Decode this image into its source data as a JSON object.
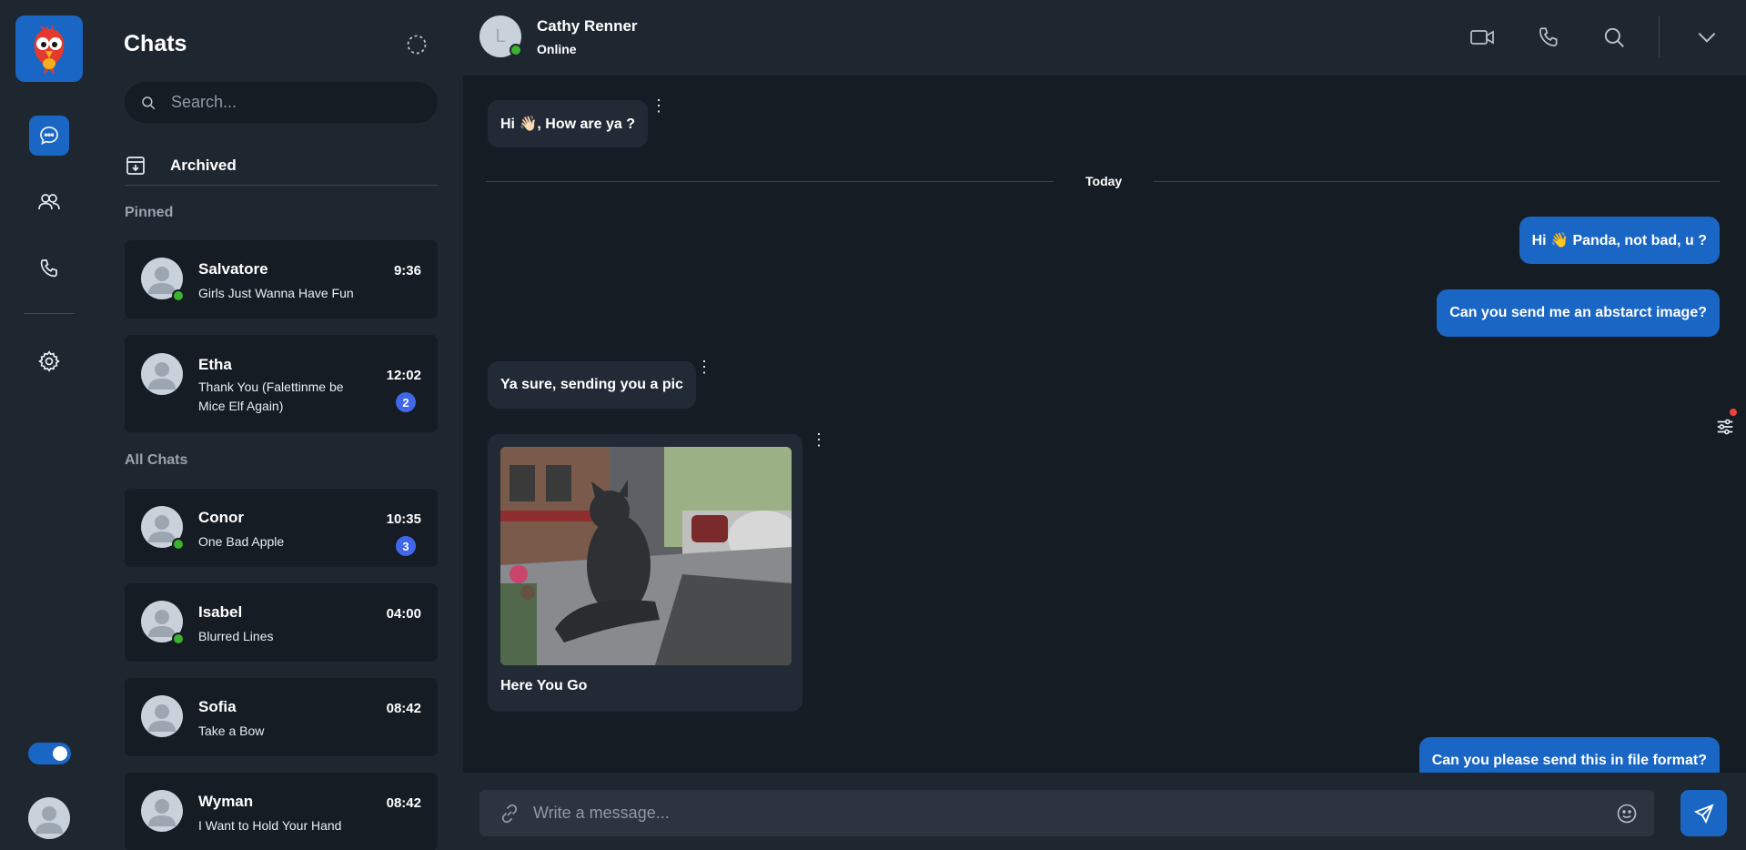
{
  "colors": {
    "accent": "#1a66c4",
    "online": "#3cb22f",
    "badge": "#3f67e8",
    "background": "#161c24",
    "panel": "#1e2630"
  },
  "sidebar": {
    "nav": [
      {
        "icon": "chat-bubble-icon",
        "active": true
      },
      {
        "icon": "users-icon",
        "active": false
      },
      {
        "icon": "phone-icon",
        "active": false
      },
      {
        "icon": "gear-icon",
        "active": false
      }
    ],
    "theme_toggle_on": true
  },
  "chat_list": {
    "title": "Chats",
    "search_placeholder": "Search...",
    "archived_label": "Archived",
    "pinned_label": "Pinned",
    "all_label": "All Chats",
    "pinned": [
      {
        "name": "Salvatore",
        "message": "Girls Just Wanna Have Fun",
        "time": "9:36",
        "online": true,
        "unread": ""
      },
      {
        "name": "Etha",
        "message": "Thank You (Falettinme be Mice Elf Again)",
        "time": "12:02",
        "online": false,
        "unread": "2"
      }
    ],
    "all": [
      {
        "name": "Conor",
        "message": "One Bad Apple",
        "time": "10:35",
        "online": true,
        "unread": "3"
      },
      {
        "name": "Isabel",
        "message": "Blurred Lines",
        "time": "04:00",
        "online": true,
        "unread": ""
      },
      {
        "name": "Sofia",
        "message": "Take a Bow",
        "time": "08:42",
        "online": false,
        "unread": ""
      },
      {
        "name": "Wyman",
        "message": "I Want to Hold Your Hand",
        "time": "08:42",
        "online": false,
        "unread": ""
      }
    ]
  },
  "conversation": {
    "contact_initial": "L",
    "contact_name": "Cathy Renner",
    "contact_status": "Online",
    "divider_label": "Today",
    "messages": [
      {
        "direction": "in",
        "text": "Hi 👋🏻, How are ya ?"
      },
      {
        "direction": "out",
        "text": "Hi 👋 Panda, not bad, u ?"
      },
      {
        "direction": "out",
        "text": "Can you send me an abstarct image?"
      },
      {
        "direction": "in",
        "text": "Ya sure, sending you a pic"
      },
      {
        "direction": "in",
        "text": "Here You Go",
        "has_image": true
      },
      {
        "direction": "out",
        "text": "Can you please send this in file format?"
      }
    ]
  },
  "composer": {
    "placeholder": "Write a message..."
  }
}
